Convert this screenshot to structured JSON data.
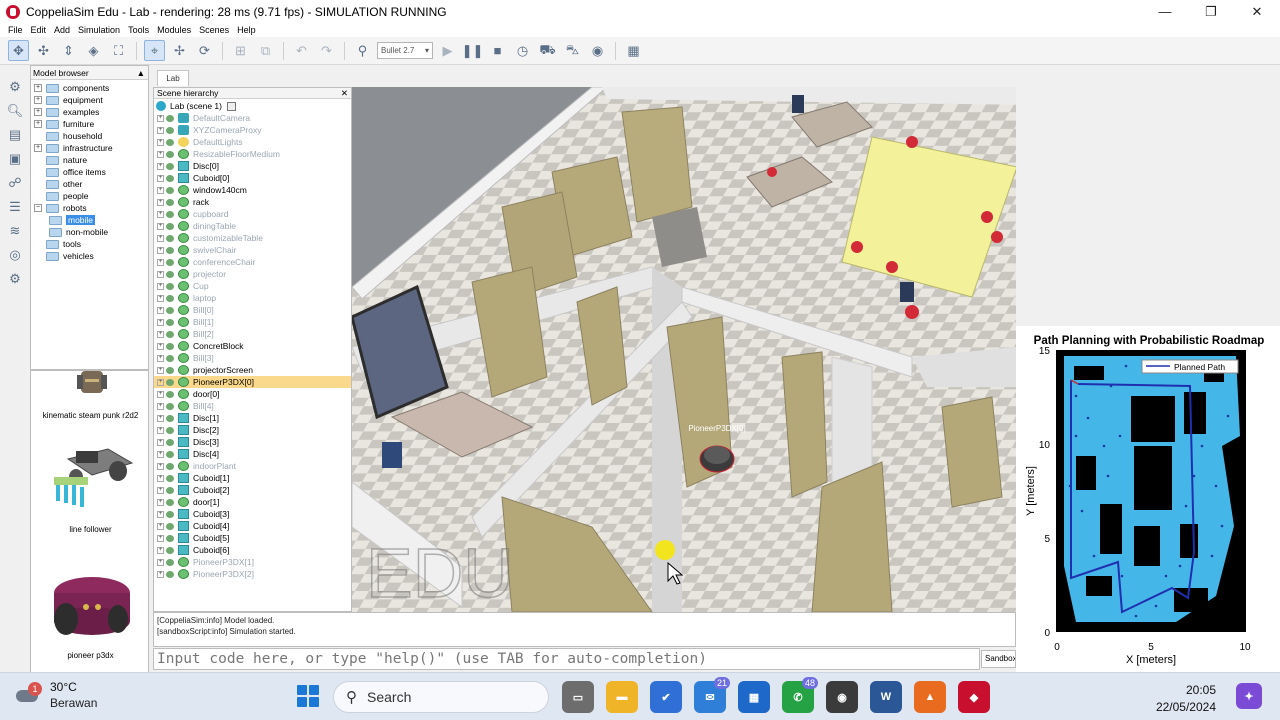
{
  "window": {
    "title": "CoppeliaSim Edu - Lab - rendering: 28 ms (9.71 fps) - SIMULATION RUNNING",
    "minimize": "—",
    "maximize": "❐",
    "close": "✕"
  },
  "menu": [
    "File",
    "Edit",
    "Add",
    "Simulation",
    "Tools",
    "Modules",
    "Scenes",
    "Help"
  ],
  "toolbar": {
    "physics_engine": "Bullet 2.7"
  },
  "model_browser": {
    "title": "Model browser",
    "items": [
      {
        "label": "components",
        "exp": "+"
      },
      {
        "label": "equipment",
        "exp": "+"
      },
      {
        "label": "examples",
        "exp": "+"
      },
      {
        "label": "furniture",
        "exp": "+"
      },
      {
        "label": "household",
        "exp": ""
      },
      {
        "label": "infrastructure",
        "exp": "+"
      },
      {
        "label": "nature",
        "exp": ""
      },
      {
        "label": "office items",
        "exp": ""
      },
      {
        "label": "other",
        "exp": ""
      },
      {
        "label": "people",
        "exp": ""
      },
      {
        "label": "robots",
        "exp": "−"
      },
      {
        "label": "mobile",
        "exp": ""
      },
      {
        "label": "non-mobile",
        "exp": ""
      },
      {
        "label": "tools",
        "exp": ""
      },
      {
        "label": "vehicles",
        "exp": ""
      }
    ],
    "thumbnails": [
      "kinematic steam punk r2d2",
      "line follower",
      "pioneer p3dx"
    ]
  },
  "scene_tab": "Lab",
  "scene_hierarchy": {
    "title": "Scene hierarchy",
    "root": "Lab (scene 1)",
    "rows": [
      {
        "label": "DefaultCamera",
        "icon": "cam",
        "dim": true
      },
      {
        "label": "XYZCameraProxy",
        "icon": "cam",
        "dim": true
      },
      {
        "label": "DefaultLights",
        "icon": "light",
        "dim": true
      },
      {
        "label": "ResizableFloorMedium",
        "icon": "model",
        "dim": true
      },
      {
        "label": "Disc[0]",
        "icon": "cube",
        "dim": false
      },
      {
        "label": "Cuboid[0]",
        "icon": "cube",
        "dim": false
      },
      {
        "label": "window140cm",
        "icon": "model",
        "dim": false
      },
      {
        "label": "rack",
        "icon": "model",
        "dim": false
      },
      {
        "label": "cupboard",
        "icon": "model",
        "dim": true
      },
      {
        "label": "diningTable",
        "icon": "model",
        "dim": true
      },
      {
        "label": "customizableTable",
        "icon": "model",
        "dim": true
      },
      {
        "label": "swivelChair",
        "icon": "model",
        "dim": true
      },
      {
        "label": "conferenceChair",
        "icon": "model",
        "dim": true
      },
      {
        "label": "projector",
        "icon": "model",
        "dim": true
      },
      {
        "label": "Cup",
        "icon": "model",
        "dim": true
      },
      {
        "label": "laptop",
        "icon": "model",
        "dim": true
      },
      {
        "label": "Bill[0]",
        "icon": "model",
        "dim": true
      },
      {
        "label": "Bill[1]",
        "icon": "model",
        "dim": true
      },
      {
        "label": "Bill[2]",
        "icon": "model",
        "dim": true
      },
      {
        "label": "ConcretBlock",
        "icon": "model",
        "dim": false
      },
      {
        "label": "Bill[3]",
        "icon": "model",
        "dim": true
      },
      {
        "label": "projectorScreen",
        "icon": "model",
        "dim": false
      },
      {
        "label": "PioneerP3DX[0]",
        "icon": "model",
        "dim": false,
        "selected": true
      },
      {
        "label": "door[0]",
        "icon": "model",
        "dim": false
      },
      {
        "label": "Bill[4]",
        "icon": "model",
        "dim": true
      },
      {
        "label": "Disc[1]",
        "icon": "cube",
        "dim": false
      },
      {
        "label": "Disc[2]",
        "icon": "cube",
        "dim": false
      },
      {
        "label": "Disc[3]",
        "icon": "cube",
        "dim": false
      },
      {
        "label": "Disc[4]",
        "icon": "cube",
        "dim": false
      },
      {
        "label": "indoorPlant",
        "icon": "model",
        "dim": true
      },
      {
        "label": "Cuboid[1]",
        "icon": "cube",
        "dim": false
      },
      {
        "label": "Cuboid[2]",
        "icon": "cube",
        "dim": false
      },
      {
        "label": "door[1]",
        "icon": "model",
        "dim": false
      },
      {
        "label": "Cuboid[3]",
        "icon": "cube",
        "dim": false
      },
      {
        "label": "Cuboid[4]",
        "icon": "cube",
        "dim": false
      },
      {
        "label": "Cuboid[5]",
        "icon": "cube",
        "dim": false
      },
      {
        "label": "Cuboid[6]",
        "icon": "cube",
        "dim": false
      },
      {
        "label": "PioneerP3DX[1]",
        "icon": "model",
        "dim": true
      },
      {
        "label": "PioneerP3DX[2]",
        "icon": "model",
        "dim": true
      }
    ]
  },
  "viewport": {
    "robot_label": "PioneerP3DX[0]",
    "watermark": "EDU"
  },
  "plot": {
    "title": "Path Planning with Probabilistic Roadmap",
    "legend": "Planned Path",
    "xlabel": "X [meters]",
    "ylabel": "Y [meters]",
    "xticks": [
      "0",
      "5",
      "10"
    ],
    "yticks": [
      "15",
      "10",
      "5",
      "0"
    ]
  },
  "console": {
    "lines": [
      "[CoppeliaSim:info] Model loaded.",
      "[sandboxScript:info] Simulation started."
    ],
    "input_placeholder": "Input code here, or type \"help()\" (use TAB for auto-completion)",
    "script_selector": "Sandbox script"
  },
  "taskbar": {
    "weather_temp": "30°C",
    "weather_desc": "Berawan",
    "weather_badge": "1",
    "search_label": "Search",
    "mail_badge": "21",
    "whatsapp_badge": "48",
    "time": "20:05",
    "date": "22/05/2024"
  },
  "colors": {
    "selection_row": "#fbd98c",
    "path_line": "#1f2fb0",
    "free_space": "#45b6e8",
    "obstacles": "#000000"
  }
}
